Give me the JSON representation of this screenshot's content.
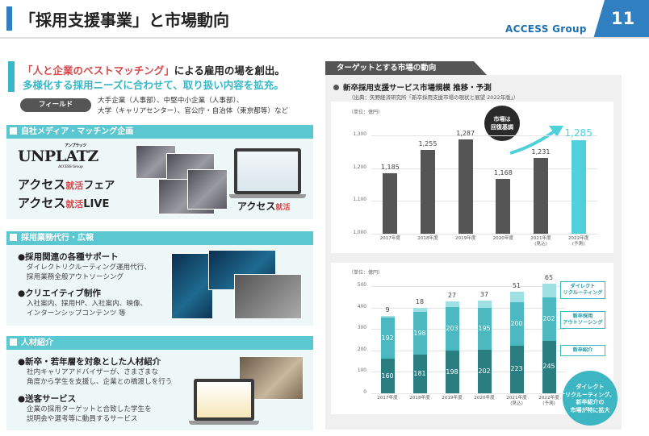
{
  "header": {
    "title": "「採用支援事業」と市場動向",
    "brand": "ACCESS Group",
    "page_number": "11"
  },
  "lead": {
    "line1_quote": "「人と企業のベストマッチング」",
    "line1_rest": "による雇用の場を創出。",
    "line2": "多様化する採用ニーズに合わせて、取り扱い内容を拡充。"
  },
  "field": {
    "label": "フィールド",
    "text1": "大手企業（人事部）、中堅中小企業（人事部）、",
    "text2": "大学（キャリアセンター）、官公庁・自治体（東京都等）など"
  },
  "section1": {
    "title": "自社メディア・マッチング企画",
    "unplatz": "UNPLATZ",
    "unplatz_small": "アンプラッツ",
    "unplatz_sub": "ACCESS Group",
    "fair_main": "アクセス",
    "fair_red": "就活",
    "fair_suffix": "フェア",
    "live_main": "アクセス",
    "live_red": "就活",
    "live_suffix": "LIVE",
    "laptop_main": "アクセス",
    "laptop_red": "就活"
  },
  "section2": {
    "title": "採用業務代行・広報",
    "b1": "●採用関連の各種サポート",
    "b1s1": "ダイレクトリクルーティング運用代行、",
    "b1s2": "採用業務全般アウトソーシング",
    "b2": "●クリエイティブ制作",
    "b2s1": "入社案内、採用HP、入社案内、映像、",
    "b2s2": "インターンシップコンテンツ 等"
  },
  "section3": {
    "title": "人材紹介",
    "b1": "●新卒・若年層を対象とした人材紹介",
    "b1s1": "社内キャリアアドバイザーが、さまざまな",
    "b1s2": "角度から学生を支援し、企業との橋渡しを行う",
    "b2": "●送客サービス",
    "b2s1": "企業の採用ターゲットと合致した学生を",
    "b2s2": "説明会や選考等に動員するサービス"
  },
  "right": {
    "tab": "ターゲットとする市場の動向",
    "chart_title": "新卒採用支援サービス市場規模 推移・予測",
    "source": "（出典：矢野経済研究所「新卒採用支援市場の現状と展望 2022年版」）",
    "unit1": "（単位：億円）",
    "unit2": "（単位：億円）",
    "bubble1": [
      "市場は",
      "回復基調"
    ],
    "bubble2": [
      "ダイレクト",
      "リクルーティング、",
      "新卒紹介の",
      "市場が特に拡大"
    ]
  },
  "chart_data": [
    {
      "type": "bar",
      "unit": "（単位：億円）",
      "categories": [
        "2017年度",
        "2018年度",
        "2019年度",
        "2020年度",
        "2021年度\n(見込)",
        "2022年度\n(予測)"
      ],
      "values": [
        1185,
        1255,
        1287,
        1168,
        1231,
        1285
      ],
      "ylim": [
        1000,
        1300
      ],
      "yticks": [
        1000,
        1100,
        1200,
        1300
      ],
      "highlight_index": 5,
      "colors": {
        "base": "#555555",
        "highlight": "#4fd0da"
      }
    },
    {
      "type": "bar",
      "stacked": true,
      "unit": "（単位：億円）",
      "categories": [
        "2017年度",
        "2018年度",
        "2019年度",
        "2020年度",
        "2021年度\n(見込)",
        "2022年度\n(予測)"
      ],
      "series": [
        {
          "name": "新卒紹介",
          "values": [
            160,
            181,
            198,
            202,
            223,
            245
          ],
          "color": "#2a7d80"
        },
        {
          "name": "新卒採用アウトソーシング",
          "values": [
            192,
            198,
            203,
            195,
            200,
            202
          ],
          "color": "#4cb8c0"
        },
        {
          "name": "ダイレクトリクルーティング",
          "values": [
            9,
            18,
            27,
            37,
            51,
            65
          ],
          "color": "#9ee0e4"
        }
      ],
      "ylim": [
        0,
        500
      ],
      "yticks": [
        0,
        100,
        200,
        300,
        400,
        500
      ]
    }
  ]
}
